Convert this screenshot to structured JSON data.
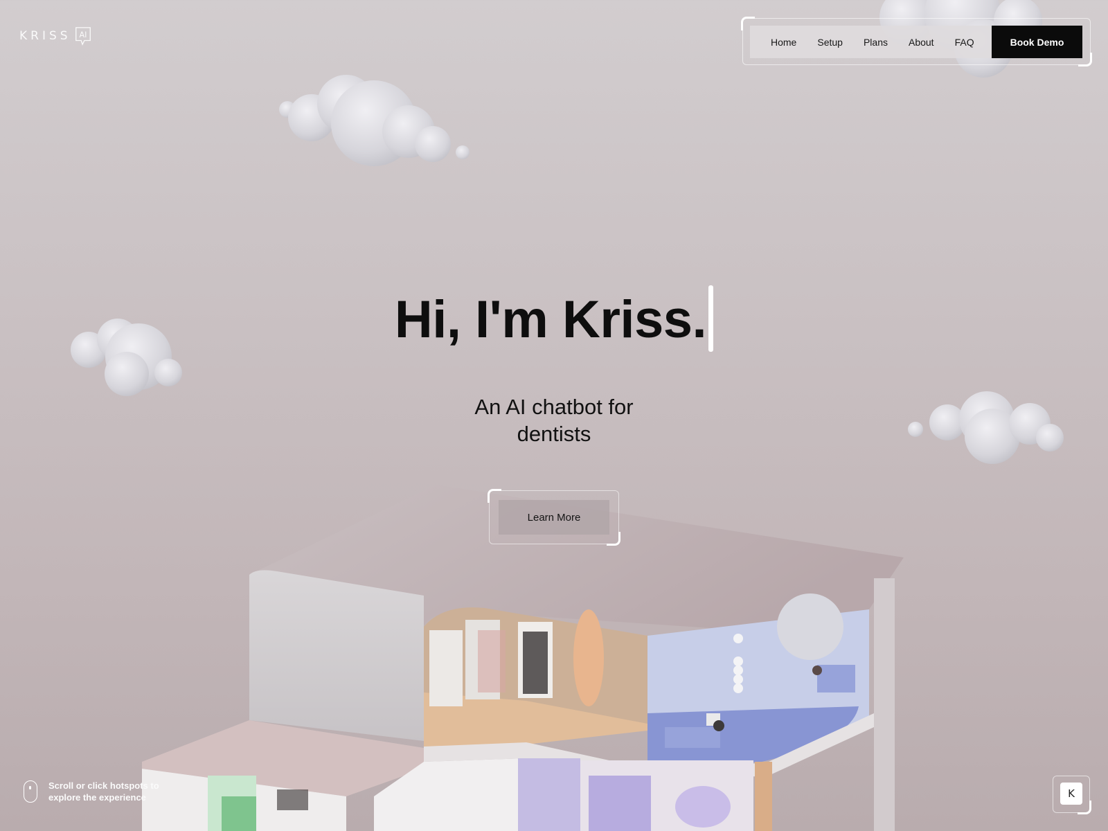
{
  "brand": {
    "name": "KRISS",
    "mark": "AI",
    "icon": "speech-bubble-logo-icon"
  },
  "nav": {
    "links": [
      "Home",
      "Setup",
      "Plans",
      "About",
      "FAQ"
    ],
    "cta_label": "Book Demo"
  },
  "hero": {
    "title": "Hi, I'm Kriss.",
    "subtitle_line1": "An AI chatbot for",
    "subtitle_line2": "dentists",
    "cta_label": "Learn More"
  },
  "footer": {
    "scroll_hint": "Scroll or click hotspots to explore the experience",
    "mouse_icon": "mouse-icon",
    "corner_button_label": "K"
  },
  "colors": {
    "background": "#cbc3c5",
    "text_dark": "#0e0e0e",
    "cta_dark": "#0b0b0b",
    "floor_blue": "#7f8fcf",
    "floor_peach": "#e3bf9b",
    "floor_green": "#aee0b6"
  }
}
